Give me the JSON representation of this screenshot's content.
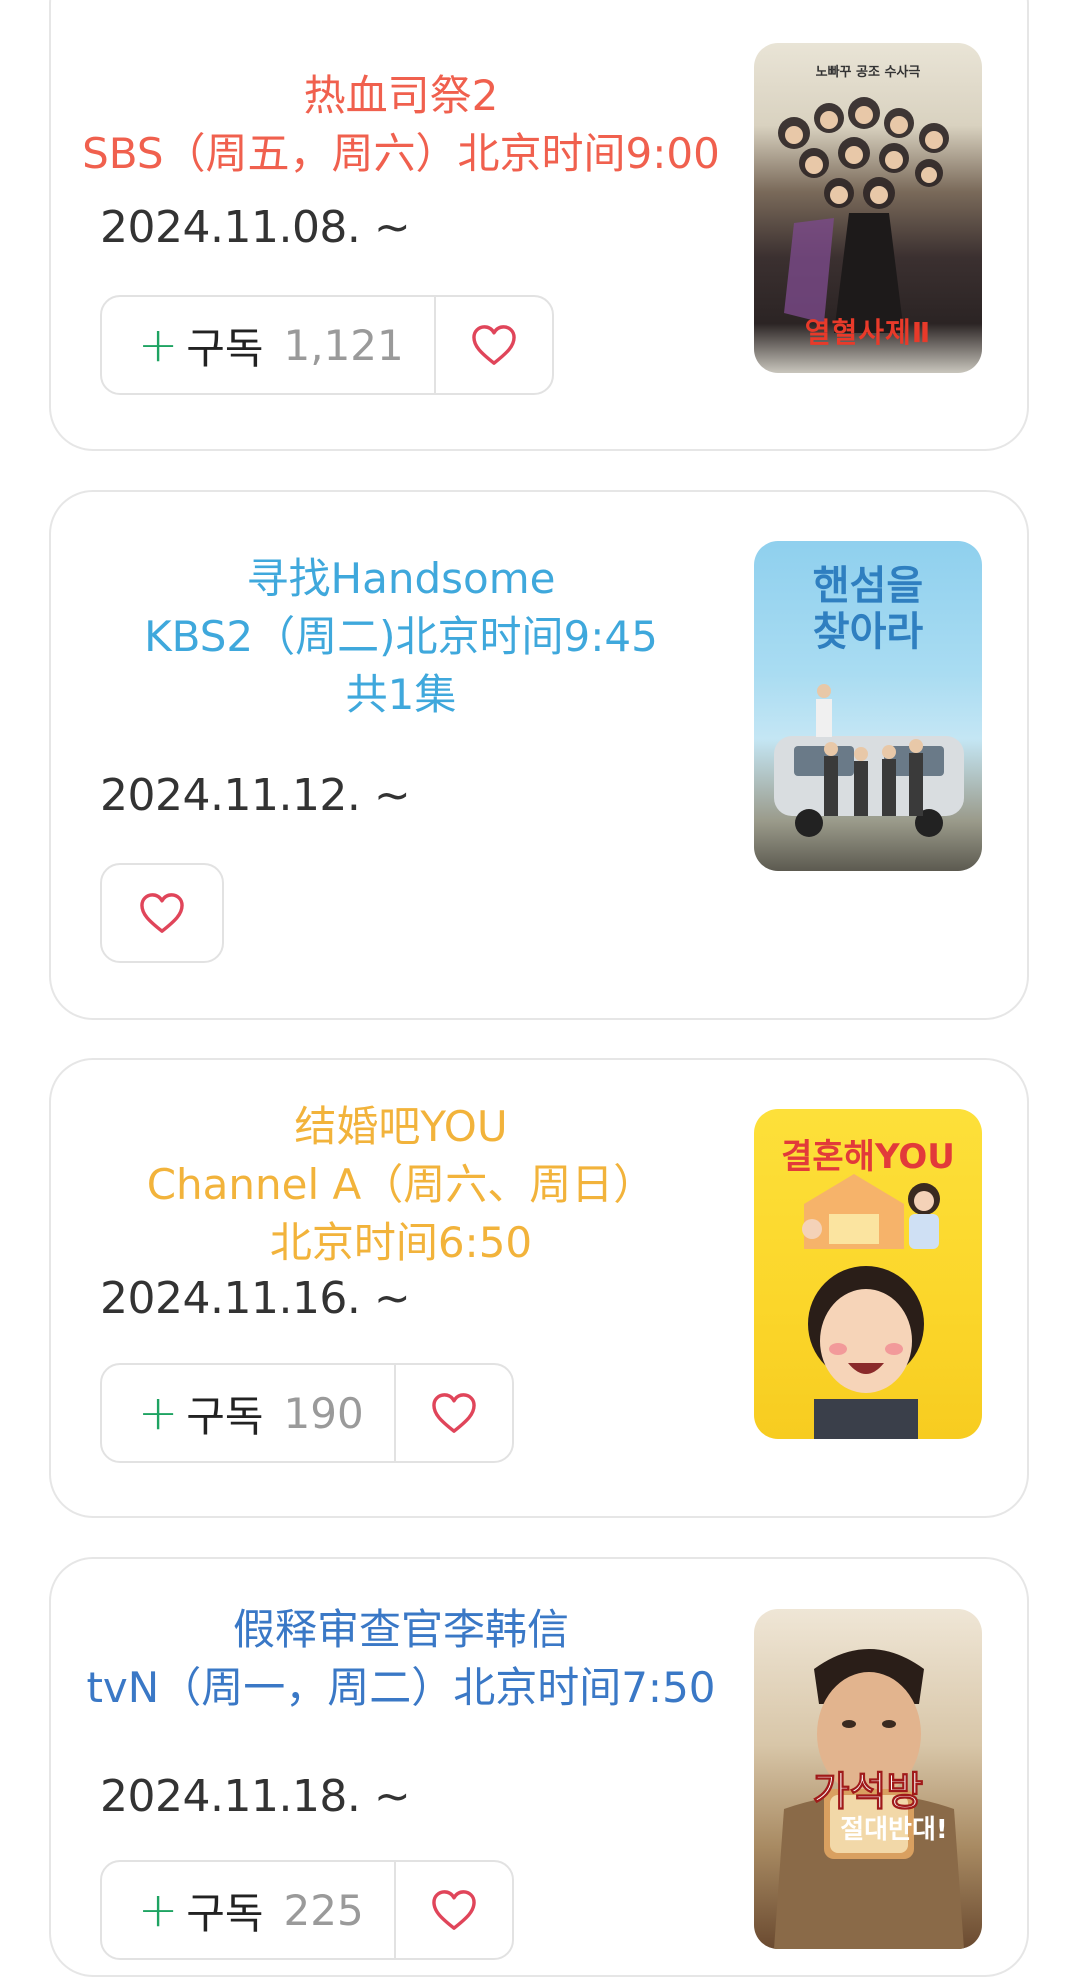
{
  "shows": [
    {
      "title": "热血司祭2\nSBS（周五，周六）北京时间9:00",
      "date": "2024.11.08. ~",
      "subscribe_label": "구독",
      "subscribe_count": "1,121",
      "poster_text": "열혈사제Ⅱ",
      "poster_tagline": "노빠꾸 공조 수사극",
      "title_color": "#f0604e"
    },
    {
      "title": "寻找Handsome\nKBS2（周二)北京时间9:45\n共1集",
      "date": "2024.11.12. ~",
      "poster_text": "핸섬을\n찾아라",
      "title_color": "#3fa8dc"
    },
    {
      "title": "结婚吧YOU\nChannel A（周六、周日）\n北京时间6:50",
      "date": "2024.11.16. ~",
      "subscribe_label": "구독",
      "subscribe_count": "190",
      "poster_text": "결혼해YOU",
      "title_color": "#f2b33b"
    },
    {
      "title": "假释审查官李韩信\ntvN（周一，周二）北京时间7:50",
      "date": "2024.11.18. ~",
      "subscribe_label": "구독",
      "subscribe_count": "225",
      "poster_text": "가석방",
      "poster_sub": "절대반대!",
      "title_color": "#3a78c6"
    }
  ],
  "colors": {
    "plus": "#1ea362",
    "heart": "#e0455a",
    "border": "#e6e6e6"
  },
  "icons": {
    "add": "plus-icon",
    "favorite": "heart-icon"
  }
}
